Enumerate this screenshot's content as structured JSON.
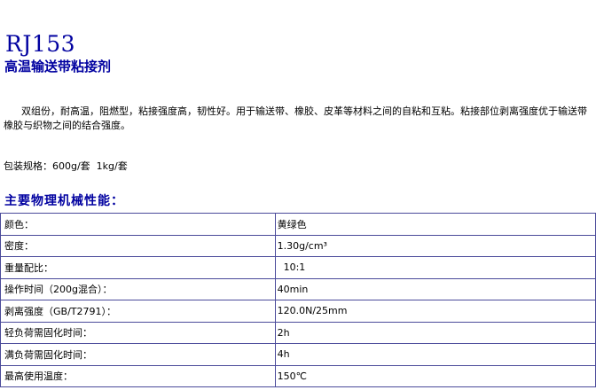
{
  "product": {
    "model": "RJ153",
    "name": "高温输送带粘接剂"
  },
  "description": "双组份，耐高温，阻燃型，粘接强度高，韧性好。用于输送带、橡胶、皮革等材料之间的自粘和互粘。粘接部位剥离强度优于输送带橡胶与织物之间的结合强度。",
  "packing": "包装规格：600g/套  1kg/套",
  "section_title": "主要物理机械性能：",
  "properties": [
    {
      "label": "颜色：",
      "value": "黄绿色"
    },
    {
      "label": "密度：",
      "value": "1.30g/cm³"
    },
    {
      "label": "重量配比：",
      "value": "  10:1"
    },
    {
      "label": "操作时间（200g混合）：",
      "value": "40min"
    },
    {
      "label": "剥离强度（GB/T2791）：",
      "value": "120.0N/25mm"
    },
    {
      "label": "轻负荷需固化时间：",
      "value": "2h"
    },
    {
      "label": "满负荷需固化时间：",
      "value": "4h"
    },
    {
      "label": "最高使用温度：",
      "value": "150℃"
    }
  ]
}
